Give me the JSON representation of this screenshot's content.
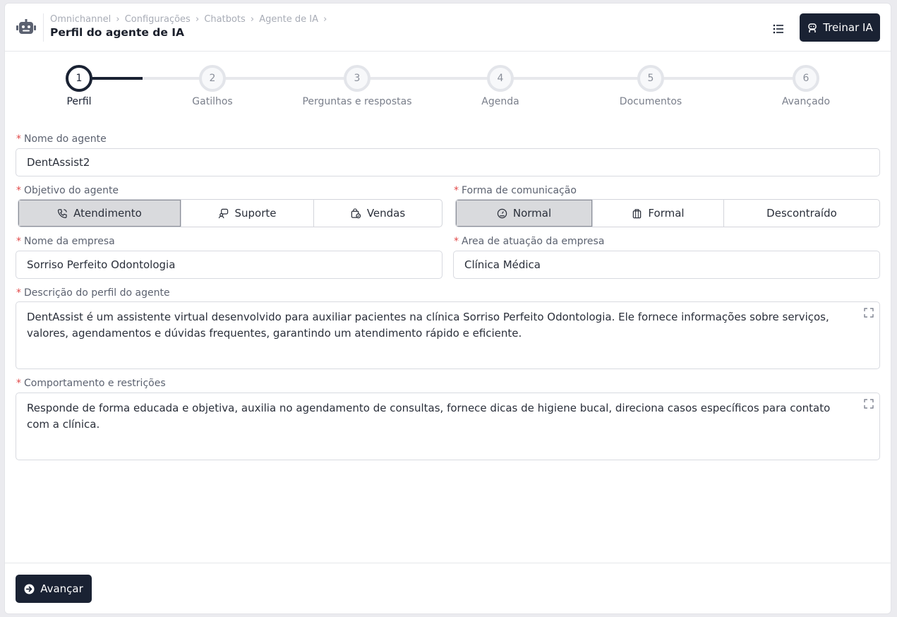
{
  "header": {
    "breadcrumbs": [
      "Omnichannel",
      "Configurações",
      "Chatbots",
      "Agente de IA"
    ],
    "separator": "›",
    "title": "Perfil do agente de IA",
    "train_label": "Treinar IA"
  },
  "stepper": {
    "steps": [
      {
        "number": "1",
        "label": "Perfil"
      },
      {
        "number": "2",
        "label": "Gatilhos"
      },
      {
        "number": "3",
        "label": "Perguntas e respostas"
      },
      {
        "number": "4",
        "label": "Agenda"
      },
      {
        "number": "5",
        "label": "Documentos"
      },
      {
        "number": "6",
        "label": "Avançado"
      }
    ],
    "active_step": 1
  },
  "form": {
    "required_mark": "*",
    "agent_name": {
      "label": "Nome do agente",
      "value": "DentAssist2"
    },
    "objective": {
      "label": "Objetivo do agente",
      "options": [
        "Atendimento",
        "Suporte",
        "Vendas"
      ],
      "selected": "Atendimento"
    },
    "communication": {
      "label": "Forma de comunicação",
      "options": [
        "Normal",
        "Formal",
        "Descontraído"
      ],
      "selected": "Normal"
    },
    "company_name": {
      "label": "Nome da empresa",
      "value": "Sorriso Perfeito Odontologia"
    },
    "company_area": {
      "label": "Area de atuação da empresa",
      "value": "Clínica Médica"
    },
    "description": {
      "label": "Descrição do perfil do agente",
      "value": "DentAssist é um assistente virtual desenvolvido para auxiliar pacientes na clínica Sorriso Perfeito Odontologia. Ele fornece informações sobre serviços, valores, agendamentos e dúvidas frequentes, garantindo um atendimento rápido e eficiente."
    },
    "behavior": {
      "label": "Comportamento e restrições",
      "value": "Responde de forma educada e objetiva, auxilia no agendamento de consultas, fornece dicas de higiene bucal, direciona casos específicos para contato com a clínica."
    }
  },
  "footer": {
    "next_label": "Avançar"
  },
  "colors": {
    "primary": "#1a2233",
    "required": "#e24a4a",
    "selected_option": "#d9dadd"
  }
}
